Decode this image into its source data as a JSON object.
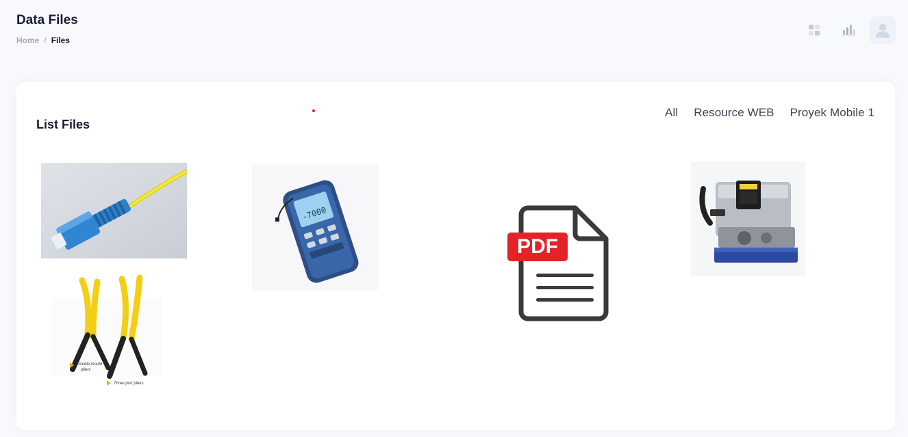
{
  "header": {
    "title": "Data Files",
    "breadcrumb": {
      "home": "Home",
      "separator": "/",
      "current": "Files"
    },
    "actions": [
      "apps-grid-icon",
      "chart-bars-icon",
      "user-avatar-icon"
    ]
  },
  "main": {
    "card_title": "List Files",
    "filters": [
      {
        "label": "All"
      },
      {
        "label": "Resource WEB"
      },
      {
        "label": "Proyek Mobile 1"
      }
    ],
    "files": [
      {
        "icon": "fiber-connector-image"
      },
      {
        "icon": "optical-power-meter-image"
      },
      {
        "icon": "pdf-file-icon",
        "badge": "PDF"
      },
      {
        "icon": "fiber-cleaver-image"
      },
      {
        "icon": "fiber-stripper-pliers-image",
        "captions": [
          "Double mouth",
          "pliers",
          "Three port pliers"
        ]
      }
    ]
  },
  "colors": {
    "background": "#f8f9fc",
    "card": "#ffffff",
    "pdf_red": "#e3232a",
    "pdf_outline": "#3a3a3a",
    "cable_yellow": "#e8d820",
    "connector_blue": "#2e7fc8"
  }
}
